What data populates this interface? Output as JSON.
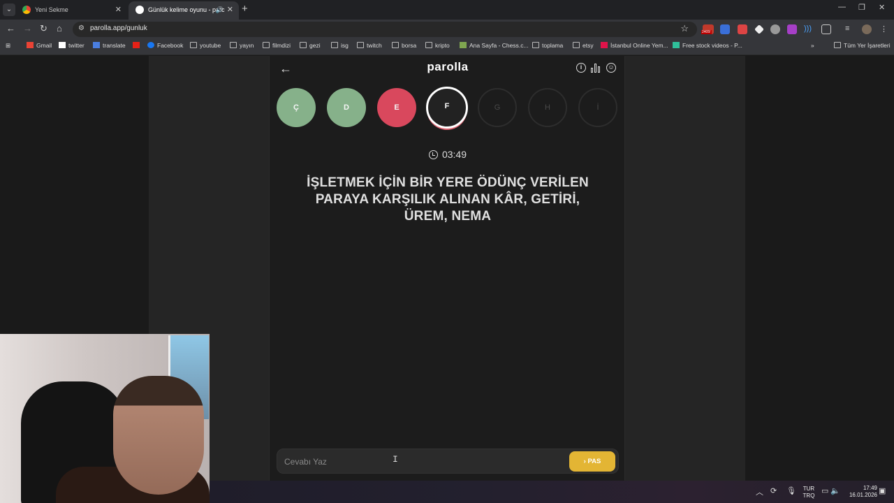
{
  "browser": {
    "tabs": [
      {
        "title": "Yeni Sekme"
      },
      {
        "title": "Günlük kelime oyunu - parc"
      }
    ],
    "url": "parolla.app/gunluk",
    "bookmarks": [
      "Gmail",
      "twitter",
      "translate",
      "Facebook",
      "youtube",
      "yayın",
      "filmdizi",
      "gezi",
      "isg",
      "twitch",
      "borsa",
      "kripto",
      "Ana Sayfa - Chess.c...",
      "toplama",
      "etsy",
      "İstanbul Online Yem...",
      "Free stock videos - P..."
    ],
    "all_bookmarks": "Tüm Yer İşaretleri",
    "extension_badge": "2405!"
  },
  "app": {
    "logo": "parolla",
    "letters": [
      {
        "char": "Ç",
        "state": "correct"
      },
      {
        "char": "D",
        "state": "correct"
      },
      {
        "char": "E",
        "state": "wrong"
      },
      {
        "char": "F",
        "state": "current"
      },
      {
        "char": "G",
        "state": "pending"
      },
      {
        "char": "H",
        "state": "pending"
      },
      {
        "char": "İ",
        "state": "pending"
      }
    ],
    "timer": "03:49",
    "question": "İŞLETMEK İÇİN BİR YERE ÖDÜNÇ VERİLEN PARAYA KARŞILIK ALINAN KÂR, GETİRİ, ÜREM, NEMA",
    "answer_placeholder": "Cevabı Yaz",
    "pass_label": "PAS"
  },
  "taskbar": {
    "lang_top": "TUR",
    "lang_bottom": "TRQ",
    "time": "17:49",
    "date": "16.01.2026"
  },
  "colors": {
    "correct": "#86b18a",
    "wrong": "#d9485d",
    "pass_button": "#e3b534"
  }
}
